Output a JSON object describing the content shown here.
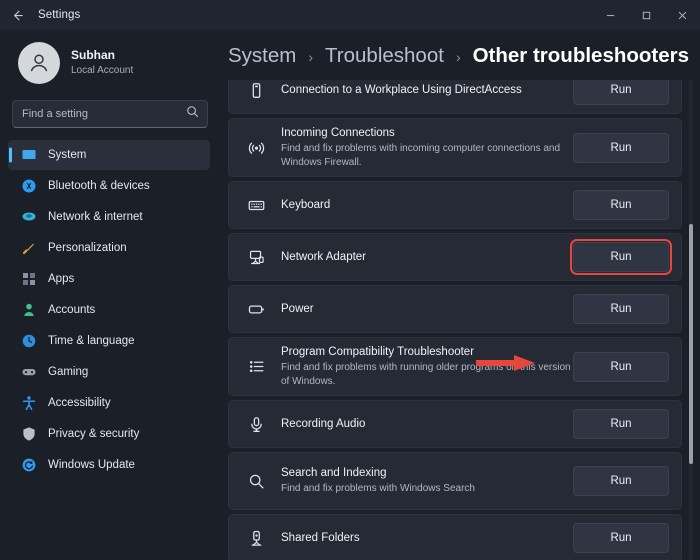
{
  "window": {
    "title": "Settings",
    "back_icon": "arrow-left-icon",
    "controls": {
      "minimize": "─",
      "maximize": "☐",
      "close": "✕"
    }
  },
  "sidebar": {
    "account": {
      "name": "Subhan",
      "subtitle": "Local Account",
      "avatar_icon": "person-avatar-icon"
    },
    "search": {
      "placeholder": "Find a setting",
      "value": "",
      "icon": "search-icon"
    },
    "items": [
      {
        "label": "System",
        "icon": "monitor-icon",
        "active": true,
        "color": "#3fa8e8"
      },
      {
        "label": "Bluetooth & devices",
        "icon": "bluetooth-icon",
        "active": false,
        "color": "#2e9bf0"
      },
      {
        "label": "Network & internet",
        "icon": "wifi-icon",
        "active": false,
        "color": "#2fb3d9"
      },
      {
        "label": "Personalization",
        "icon": "paintbrush-icon",
        "active": false,
        "color": "#e8a13a"
      },
      {
        "label": "Apps",
        "icon": "apps-grid-icon",
        "active": false,
        "color": "#8a93a3"
      },
      {
        "label": "Accounts",
        "icon": "person-icon",
        "active": false,
        "color": "#3fc08a"
      },
      {
        "label": "Time & language",
        "icon": "clock-icon",
        "active": false,
        "color": "#2f8fd8"
      },
      {
        "label": "Gaming",
        "icon": "gamepad-icon",
        "active": false,
        "color": "#9aa1ae"
      },
      {
        "label": "Accessibility",
        "icon": "accessibility-icon",
        "active": false,
        "color": "#2e9bf0"
      },
      {
        "label": "Privacy & security",
        "icon": "shield-icon",
        "active": false,
        "color": "#b9c0cc"
      },
      {
        "label": "Windows Update",
        "icon": "update-refresh-icon",
        "active": false,
        "color": "#2e9bf0"
      }
    ]
  },
  "breadcrumb": {
    "items": [
      {
        "label": "System",
        "current": false
      },
      {
        "label": "Troubleshoot",
        "current": false
      },
      {
        "label": "Other troubleshooters",
        "current": true
      }
    ],
    "separator": "›"
  },
  "troubleshooters": {
    "run_label": "Run",
    "rows": [
      {
        "title": "Connection to a Workplace Using DirectAccess",
        "description": "",
        "icon": "device-card-icon",
        "highlighted": false
      },
      {
        "title": "Incoming Connections",
        "description": "Find and fix problems with incoming computer connections and Windows Firewall.",
        "icon": "broadcast-signal-icon",
        "highlighted": false
      },
      {
        "title": "Keyboard",
        "description": "",
        "icon": "keyboard-icon",
        "highlighted": false
      },
      {
        "title": "Network Adapter",
        "description": "",
        "icon": "network-computer-icon",
        "highlighted": true
      },
      {
        "title": "Power",
        "description": "",
        "icon": "battery-icon",
        "highlighted": false
      },
      {
        "title": "Program Compatibility Troubleshooter",
        "description": "Find and fix problems with running older programs on this version of Windows.",
        "icon": "list-bullets-icon",
        "highlighted": false
      },
      {
        "title": "Recording Audio",
        "description": "",
        "icon": "microphone-icon",
        "highlighted": false
      },
      {
        "title": "Search and Indexing",
        "description": "Find and fix problems with Windows Search",
        "icon": "search-magnifier-icon",
        "highlighted": false
      },
      {
        "title": "Shared Folders",
        "description": "",
        "icon": "shared-folder-icon",
        "highlighted": false
      }
    ]
  },
  "annotation": {
    "arrow_color": "#e8463c",
    "highlight_color": "#e8463c",
    "target": "Network Adapter Run button"
  },
  "scrollbar": {
    "thumb_top_pct": 30,
    "thumb_height_pct": 50
  }
}
